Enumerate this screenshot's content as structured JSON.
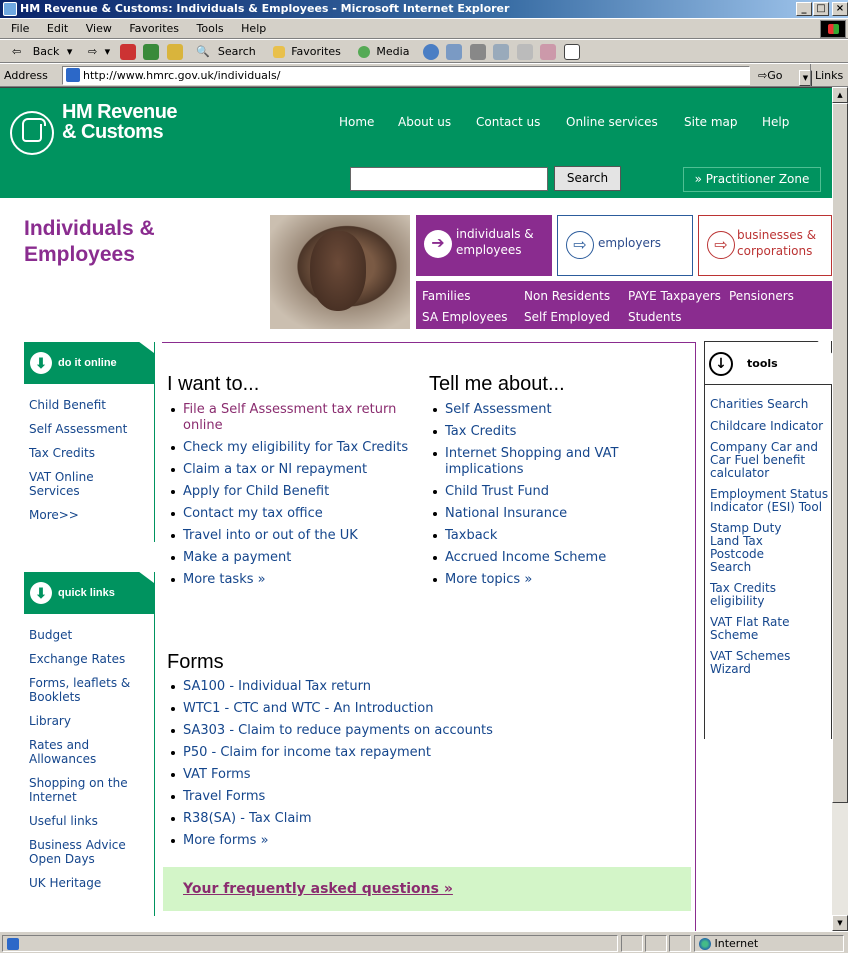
{
  "window": {
    "title": "HM Revenue & Customs: Individuals & Employees - Microsoft Internet Explorer",
    "controls": [
      "_",
      "□",
      "×"
    ]
  },
  "menu": [
    "File",
    "Edit",
    "View",
    "Favorites",
    "Tools",
    "Help"
  ],
  "toolbar": {
    "back": "Back",
    "search": "Search",
    "favorites": "Favorites",
    "media": "Media"
  },
  "address": {
    "label": "Address",
    "url": "http://www.hmrc.gov.uk/individuals/",
    "go": "Go",
    "links": "Links"
  },
  "site": {
    "logo_line1": "HM Revenue",
    "logo_line2": "& Customs",
    "nav": [
      "Home",
      "About us",
      "Contact us",
      "Online services",
      "Site map",
      "Help"
    ],
    "search_button": "Search",
    "practitioner": "» Practitioner Zone",
    "section_title_1": "Individuals &",
    "section_title_2": "Employees",
    "tabs": {
      "individuals": [
        "individuals &",
        "employees"
      ],
      "employers": "employers",
      "businesses": [
        "businesses &",
        "corporations"
      ]
    },
    "purple_nav": {
      "row1": [
        "Families",
        "Non Residents",
        "PAYE Taxpayers",
        "Pensioners"
      ],
      "row2": [
        "SA Employees",
        "Self Employed",
        "Students"
      ]
    }
  },
  "do_it_online": {
    "title": "do it online",
    "items": [
      "Child Benefit",
      "Self Assessment",
      "Tax Credits",
      "VAT Online Services",
      "More>>"
    ]
  },
  "quick_links": {
    "title": "quick links",
    "items": [
      "Budget",
      "Exchange Rates",
      "Forms, leaflets & Booklets",
      "Library",
      "Rates and Allowances",
      "Shopping on the Internet",
      "Useful links",
      "Business Advice Open Days",
      "UK Heritage"
    ]
  },
  "i_want_to": {
    "title": "I want to...",
    "items": [
      "File a Self Assessment tax return online",
      "Check my eligibility for Tax Credits",
      "Claim a tax or NI repayment",
      "Apply for Child Benefit",
      "Contact my tax office",
      "Travel into or out of the UK",
      "Make a payment",
      "More tasks »"
    ]
  },
  "tell_me_about": {
    "title": "Tell me about...",
    "items": [
      "Self Assessment",
      "Tax Credits",
      "Internet Shopping and VAT implications",
      "Child Trust Fund",
      "National Insurance",
      "Taxback",
      "Accrued Income Scheme",
      "More topics »"
    ]
  },
  "forms": {
    "title": "Forms",
    "items": [
      "SA100 - Individual Tax return",
      "WTC1 - CTC and WTC - An Introduction",
      "SA303 - Claim to reduce payments on accounts",
      "P50 - Claim for income tax repayment",
      "VAT Forms",
      "Travel Forms",
      "R38(SA) - Tax Claim",
      "More forms »"
    ]
  },
  "faq": "Your frequently asked questions »",
  "tools": {
    "title": "tools",
    "items": [
      "Charities Search",
      "Childcare Indicator",
      "Company Car and Car Fuel benefit calculator",
      "Employment Status Indicator (ESI) Tool",
      "Stamp Duty Land Tax Postcode Search",
      "Tax Credits eligibility",
      "VAT Flat Rate Scheme",
      "VAT Schemes Wizard"
    ]
  },
  "status": {
    "zone": "Internet"
  },
  "colors": {
    "hmrc_green": "#00935f",
    "purple": "#8a2c8f",
    "link_blue": "#15468c",
    "faq_bg": "#d3f5c8"
  }
}
